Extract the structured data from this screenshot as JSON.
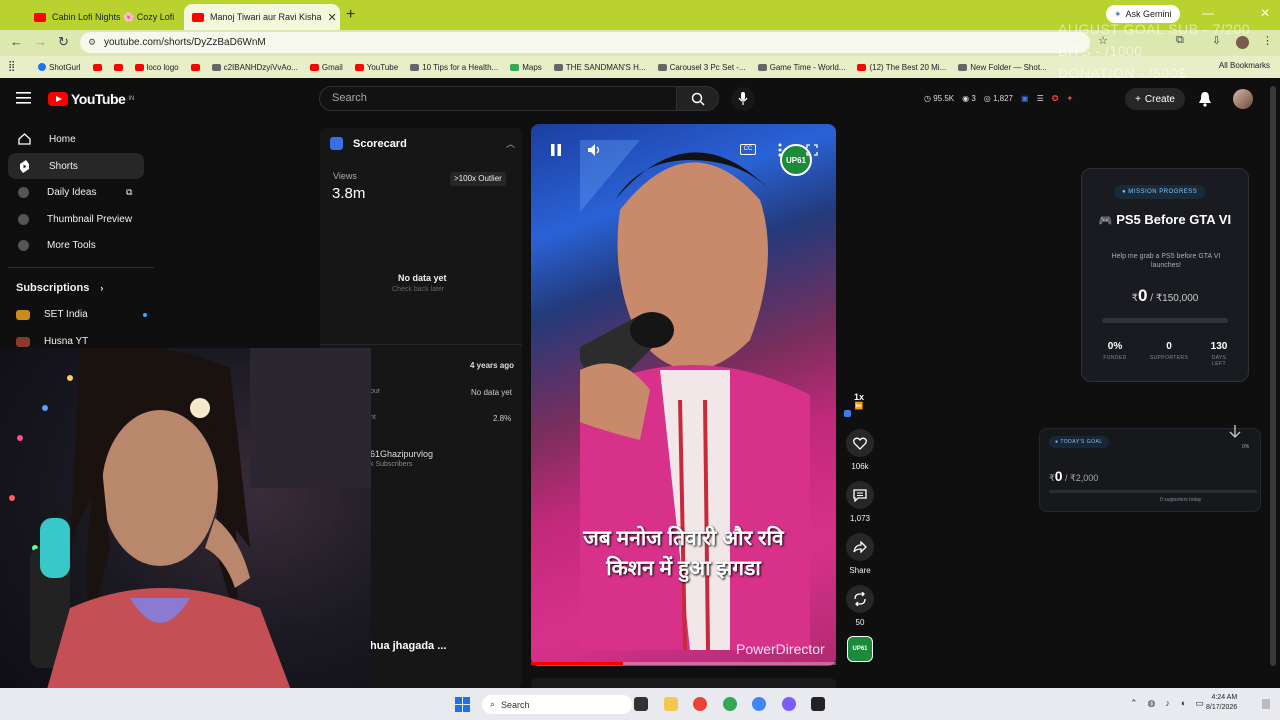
{
  "browser": {
    "tabs": [
      {
        "title": "Cabin Lofi Nights 🌸 Cozy Lofi"
      },
      {
        "title": "Manoj Tiwari aur Ravi Kisha"
      }
    ],
    "ask_gemini": "Ask Gemini",
    "url": "youtube.com/shorts/DyZzBaD6WnM",
    "bookmarks": [
      {
        "label": "ShotGurl",
        "icon": "facebook"
      },
      {
        "label": "",
        "icon": "youtube"
      },
      {
        "label": "",
        "icon": "youtube"
      },
      {
        "label": "loco logo",
        "icon": "youtube"
      },
      {
        "label": "",
        "icon": "youtube"
      },
      {
        "label": "c2IBANHDzyiVvAo...",
        "icon": "site"
      },
      {
        "label": "Gmail",
        "icon": "youtube"
      },
      {
        "label": "YouTube",
        "icon": "youtube"
      },
      {
        "label": "10 Tips for a Health...",
        "icon": "site"
      },
      {
        "label": "Maps",
        "icon": "maps"
      },
      {
        "label": "THE SANDMAN'S H...",
        "icon": "site"
      },
      {
        "label": "Carousel 3 Pc Set -...",
        "icon": "site"
      },
      {
        "label": "Game Time - World...",
        "icon": "site"
      },
      {
        "label": "(12) The Best 20 Mi...",
        "icon": "youtube"
      },
      {
        "label": "New Folder — Shot...",
        "icon": "site"
      }
    ],
    "all_bookmarks": "All Bookmarks"
  },
  "overlay_goal": {
    "line1": "AUGUST GOAL SUB - 7/200",
    "line2": "BITS - /1000",
    "line3": "DONATION - /500$"
  },
  "youtube": {
    "logo_text": "YouTube",
    "logo_region": "IN",
    "search_placeholder": "Search",
    "stats": {
      "views": "95.5K",
      "count1": "3",
      "count2": "1,827"
    },
    "create_label": "Create"
  },
  "sidebar": {
    "items": [
      {
        "label": "Home",
        "icon": "home-icon"
      },
      {
        "label": "Shorts",
        "icon": "shorts-icon"
      },
      {
        "label": "Daily Ideas",
        "icon": "ideas-icon"
      },
      {
        "label": "Thumbnail Preview",
        "icon": "thumbnail-icon"
      },
      {
        "label": "More Tools",
        "icon": "tools-icon"
      }
    ],
    "subscriptions_heading": "Subscriptions",
    "subscriptions": [
      {
        "name": "SET India"
      },
      {
        "name": "Husna YT"
      }
    ]
  },
  "scorecard": {
    "title": "Scorecard",
    "views_label": "Views",
    "views_value": "3.8m",
    "outlier_badge": ">100x Outlier",
    "no_data": "No data yet",
    "check_back": "Check back later",
    "age": "4 years ago",
    "row2_label": "our",
    "row2_value": "No data yet",
    "row3_label": "nt",
    "row3_value": "2.8%",
    "channel_name": "61Ghazipurvlog",
    "channel_subs": "k Subscribers",
    "video_title_partial": "hua jhagada ..."
  },
  "video": {
    "caption_line1": "जब मनोज तिवारी और रवि",
    "caption_line2": "किशन में हुआ झगडा",
    "watermark": "PowerDirector",
    "cc_label": "CC",
    "channel_badge": "UP61",
    "progress_percent": 30
  },
  "actions": {
    "speed": "1x",
    "likes": "106k",
    "comments": "1,073",
    "share": "Share",
    "remix": "50"
  },
  "mission": {
    "badge": "MISSION PROGRESS",
    "title": "PS5 Before GTA VI",
    "description": "Help me grab a PS5 before GTA VI launches!",
    "current": "0",
    "target": "/ ₹150,000",
    "currency": "₹",
    "funded_value": "0%",
    "funded_label": "FUNDED",
    "supporters_value": "0",
    "supporters_label": "SUPPORTERS",
    "days_value": "130",
    "days_label": "DAYS LEFT"
  },
  "today_goal": {
    "badge": "TODAY'S GOAL",
    "currency": "₹",
    "current": "0",
    "target": "/ ₹2,000",
    "supporters": "0 supporters today",
    "percent": "0%"
  },
  "taskbar": {
    "search": "Search",
    "time": "4:24 AM",
    "date": "8/17/2026"
  }
}
